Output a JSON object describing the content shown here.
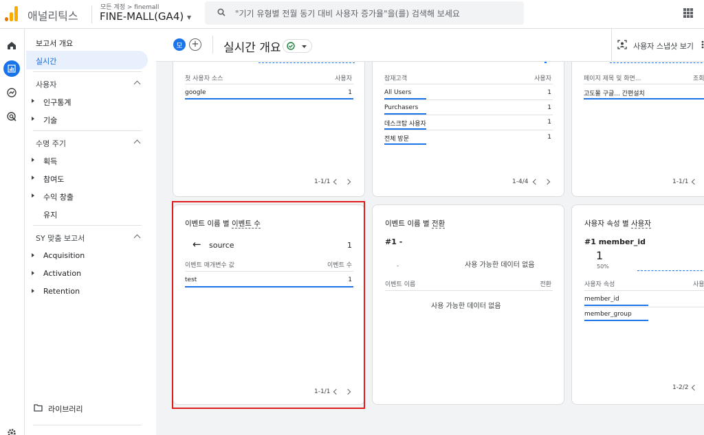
{
  "app": {
    "product": "애널리틱스",
    "account_path": "모든 계정 > finemall",
    "account_name": "FINE-MALL(GA4)",
    "search_placeholder": "\"기기 유형별 전월 동기 대비 사용자 증가율\"을(를) 검색해 보세요",
    "brand_colors": [
      "#f9ab00",
      "#e37400"
    ],
    "accent": "#1a73e8"
  },
  "nav": {
    "report_overview": "보고서 개요",
    "realtime": "실시간",
    "users_section": "사용자",
    "demographics": "인구통계",
    "tech": "기술",
    "lifecycle_section": "수명 주기",
    "acquisition": "획득",
    "engagement": "참여도",
    "monetization": "수익 창출",
    "retention": "유지",
    "custom_section": "SY 맞춤 보고서",
    "custom_items": [
      "Acquisition",
      "Activation",
      "Retention"
    ],
    "library": "라이브러리"
  },
  "subheader": {
    "avatar_letter": "모",
    "add_symbol": "+",
    "title": "실시간 개요",
    "snapshot_label": "사용자 스냅샷 보기"
  },
  "cards": {
    "first_user_source": {
      "col1": "첫 사용자 소스",
      "col2": "사용자",
      "rows": [
        {
          "label": "google",
          "value": "1"
        }
      ],
      "pager": "1-1/1"
    },
    "audience": {
      "col1": "잠재고객",
      "col2": "사용자",
      "rows": [
        {
          "label": "All Users",
          "value": "1"
        },
        {
          "label": "Purchasers",
          "value": "1"
        },
        {
          "label": "데스크탑 사용자",
          "value": "1"
        },
        {
          "label": "전체 방문",
          "value": "1"
        }
      ],
      "pager": "1-4/4"
    },
    "page_title": {
      "col1": "페이지 제목 및 화면...",
      "col2": "조회",
      "rows": [
        {
          "label": "고도몰 구글... 간편설치"
        }
      ],
      "pager": "1-1/1"
    },
    "events_by_name": {
      "title_prefix": "이벤트 이름 별 ",
      "title_metric": "이벤트 수",
      "back_label": "source",
      "back_value": "1",
      "col1": "이벤트 매개변수 값",
      "col2": "이벤트 수",
      "rows": [
        {
          "label": "test",
          "value": "1"
        }
      ],
      "pager": "1-1/1"
    },
    "conversions": {
      "title_prefix": "이벤트 이름 별 ",
      "title_metric": "전환",
      "rank": "#1 -",
      "dash": "-",
      "no_data_1": "사용 가능한 데이터 없음",
      "col1": "이벤트 이름",
      "col2": "전환",
      "no_data_2": "사용 가능한 데이터 없음"
    },
    "user_props": {
      "title_prefix": "사용자 속성 별 ",
      "title_metric": "사용자",
      "rank": "#1 member_id",
      "big_value": "1",
      "percent": "50%",
      "col1": "사용자 속성",
      "col2": "사용",
      "rows": [
        {
          "label": "member_id"
        },
        {
          "label": "member_group"
        }
      ],
      "pager": "1-2/2"
    }
  }
}
